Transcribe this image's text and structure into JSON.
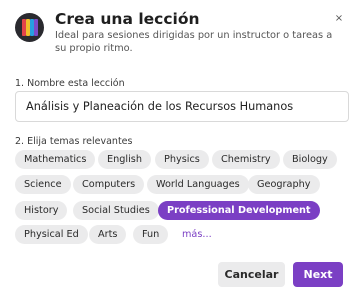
{
  "header": {
    "title": "Crea una lección",
    "subtitle": "Ideal para sesiones dirigidas por un instructor o tareas a su propio ritmo.",
    "close_glyph": "×"
  },
  "form": {
    "name_label": "1. Nombre esta lección",
    "name_value": "Análisis y Planeación de los Recursos Humanos",
    "topics_label": "2. Elija temas relevantes",
    "topics": [
      {
        "label": "Mathematics",
        "selected": false
      },
      {
        "label": "English",
        "selected": false
      },
      {
        "label": "Physics",
        "selected": false
      },
      {
        "label": "Chemistry",
        "selected": false
      },
      {
        "label": "Biology",
        "selected": false
      },
      {
        "label": "Science",
        "selected": false
      },
      {
        "label": "Computers",
        "selected": false
      },
      {
        "label": "World Languages",
        "selected": false
      },
      {
        "label": "Geography",
        "selected": false
      },
      {
        "label": "History",
        "selected": false
      },
      {
        "label": "Social Studies",
        "selected": false
      },
      {
        "label": "Professional Development",
        "selected": true
      },
      {
        "label": "Physical Ed",
        "selected": false
      },
      {
        "label": "Arts",
        "selected": false
      },
      {
        "label": "Fun",
        "selected": false
      }
    ],
    "more_label": "más..."
  },
  "footer": {
    "cancel_label": "Cancelar",
    "next_label": "Next"
  },
  "colors": {
    "accent": "#7b3fc4",
    "chip_bg": "#ebebec"
  }
}
